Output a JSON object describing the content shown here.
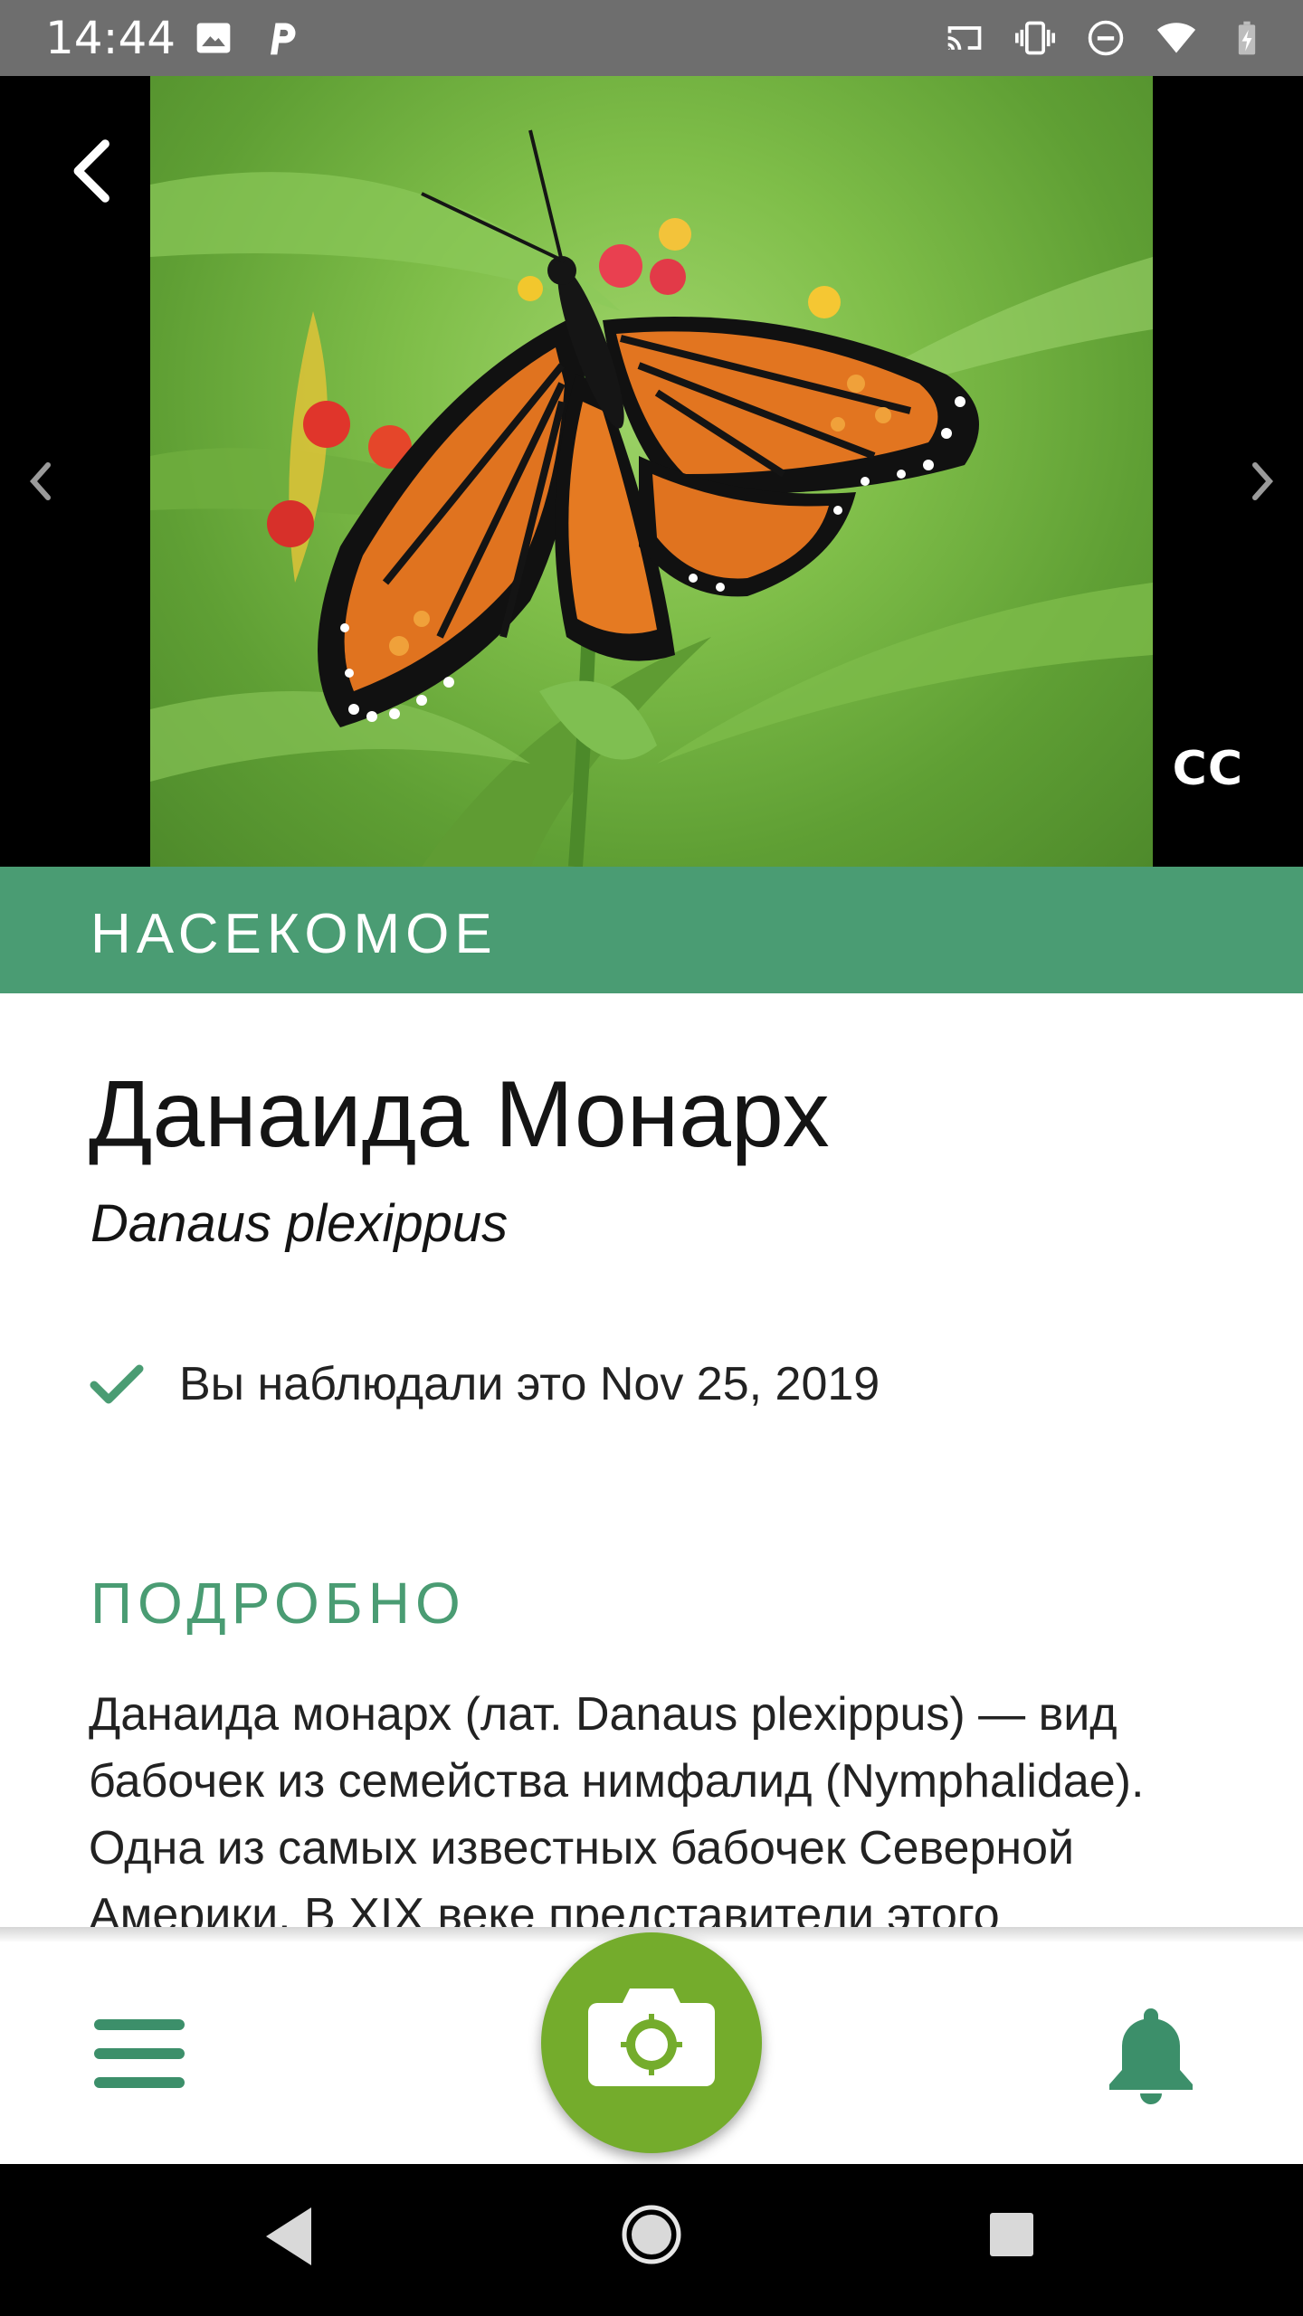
{
  "status_bar": {
    "time": "14:44",
    "left_icons": [
      "image-icon",
      "p-icon"
    ],
    "right_icons": [
      "cast-icon",
      "vibrate-icon",
      "do-not-disturb-icon",
      "wifi-icon",
      "battery-icon"
    ]
  },
  "photo": {
    "license_label": "CC",
    "subject": "monarch butterfly on milkweed flowers"
  },
  "category": {
    "label": "НАСЕКОМОЕ"
  },
  "species": {
    "common_name": "Данаида Монарх",
    "scientific_name": "Danaus plexippus",
    "observed_text": "Вы наблюдали это Nov 25, 2019"
  },
  "details": {
    "section_title": "ПОДРОБНО",
    "description": "Данаида монарх (лат. Danaus plexippus) — вид бабочек из семейства нимфалид (Nymphalidae). Одна из самых известных бабочек Северной Америки. В XIX веке представители этого"
  },
  "colors": {
    "accent_green": "#4a9c73",
    "camera_green": "#74ac2c",
    "status_bar": "#6e6e6e"
  },
  "bottom_bar": {
    "icons": [
      "menu-icon",
      "camera-icon",
      "bell-icon"
    ]
  },
  "system_nav": {
    "icons": [
      "back-icon",
      "home-icon",
      "recents-icon"
    ]
  }
}
